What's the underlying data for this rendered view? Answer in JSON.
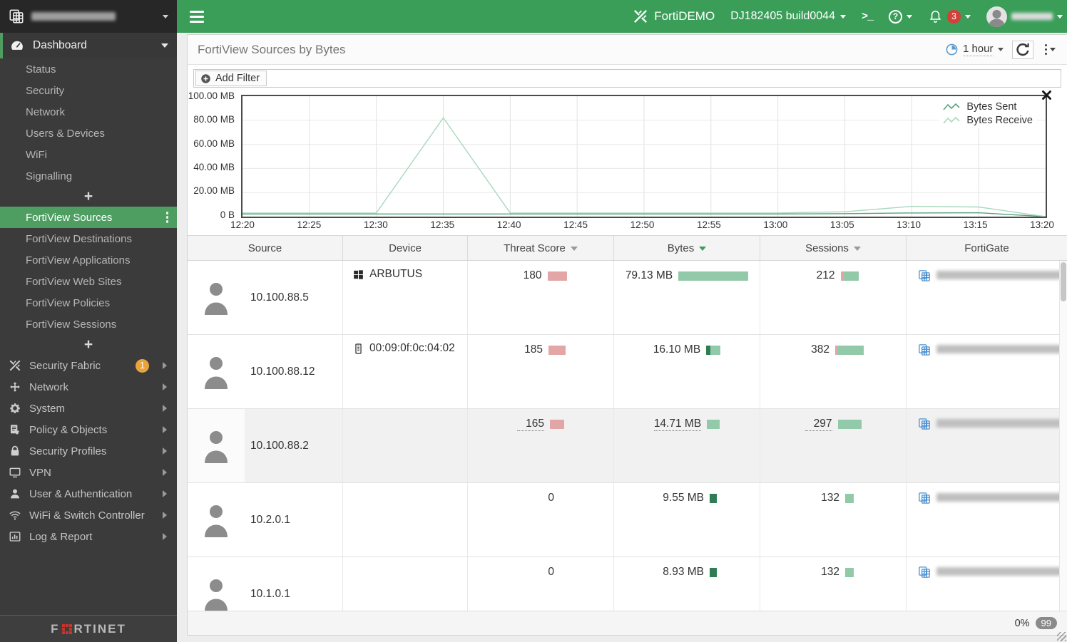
{
  "colors": {
    "topbar_green": "#3a9e59",
    "selected_green": "#4e9e61",
    "bar_light_green": "#92c9a9",
    "bar_dark_green": "#2f7d52",
    "bar_red": "#e2a6a6",
    "badge_orange": "#e8a33d",
    "badge_red": "#d43f3a",
    "line_sent": "#58a27b",
    "line_receive": "#a8d8bf",
    "fortigate_icon_blue": "#4a90d2"
  },
  "sidebar": {
    "device_name_redacted": true,
    "dashboard": {
      "label": "Dashboard"
    },
    "dashboard_items": [
      {
        "label": "Status"
      },
      {
        "label": "Security"
      },
      {
        "label": "Network"
      },
      {
        "label": "Users & Devices"
      },
      {
        "label": "WiFi"
      },
      {
        "label": "Signalling"
      }
    ],
    "add_label": "+",
    "fortiview_selected": {
      "label": "FortiView Sources"
    },
    "fortiview_items": [
      {
        "label": "FortiView Destinations"
      },
      {
        "label": "FortiView Applications"
      },
      {
        "label": "FortiView Web Sites"
      },
      {
        "label": "FortiView Policies"
      },
      {
        "label": "FortiView Sessions"
      }
    ],
    "menu_items": [
      {
        "label": "Security Fabric",
        "icon": "security-fabric",
        "badge": "1"
      },
      {
        "label": "Network",
        "icon": "network"
      },
      {
        "label": "System",
        "icon": "system-gear"
      },
      {
        "label": "Policy & Objects",
        "icon": "policy-objects"
      },
      {
        "label": "Security Profiles",
        "icon": "security-profiles"
      },
      {
        "label": "VPN",
        "icon": "vpn"
      },
      {
        "label": "User & Authentication",
        "icon": "user-auth"
      },
      {
        "label": "WiFi & Switch Controller",
        "icon": "wifi-switch"
      },
      {
        "label": "Log & Report",
        "icon": "log-report"
      }
    ],
    "footer_logo": {
      "left": "F",
      "right": "RTINET"
    }
  },
  "topbar": {
    "brand": "FortiDEMO",
    "build": "DJ182405 build0044",
    "notification_count": "3",
    "username_redacted": true
  },
  "panel": {
    "title": "FortiView Sources by Bytes",
    "time_range": "1 hour",
    "add_filter_label": "Add Filter",
    "status_percent": "0%",
    "status_badge": "99"
  },
  "chart_data": {
    "type": "line",
    "x": [
      "12:20",
      "12:25",
      "12:30",
      "12:35",
      "12:40",
      "12:45",
      "12:50",
      "12:55",
      "13:00",
      "13:05",
      "13:10",
      "13:15",
      "13:20"
    ],
    "series": [
      {
        "name": "Bytes Sent",
        "color": "#58a27b",
        "values": [
          2.2,
          2.2,
          2.2,
          2.2,
          2.2,
          2.2,
          2.2,
          2.2,
          2.2,
          2.5,
          3.0,
          3.2,
          0
        ]
      },
      {
        "name": "Bytes Receive",
        "color": "#a8d8bf",
        "values": [
          3.0,
          3.0,
          3.0,
          82.0,
          3.0,
          3.0,
          3.0,
          3.0,
          3.0,
          4.0,
          8.5,
          8.0,
          0
        ]
      }
    ],
    "unit": "MB",
    "ylim": [
      0,
      100
    ],
    "y_ticks": [
      "100.00 MB",
      "80.00 MB",
      "60.00 MB",
      "40.00 MB",
      "20.00 MB",
      "0 B"
    ],
    "grid": true,
    "legend_position": "top-right"
  },
  "table": {
    "columns": [
      {
        "label": "Source",
        "sort": "none"
      },
      {
        "label": "Device",
        "sort": "none"
      },
      {
        "label": "Threat Score",
        "sort": "inactive"
      },
      {
        "label": "Bytes",
        "sort": "active"
      },
      {
        "label": "Sessions",
        "sort": "inactive"
      },
      {
        "label": "FortiGate",
        "sort": "none"
      }
    ],
    "rows": [
      {
        "source": "10.100.88.5",
        "device": "ARBUTUS",
        "device_icon": "windows",
        "threat_score": "180",
        "threat_bar": 27,
        "bytes": "79.13 MB",
        "bytes_bar": [
          0,
          98
        ],
        "sessions": "212",
        "sessions_bar": [
          4,
          21
        ],
        "fortigate_redacted": true,
        "hovered": false
      },
      {
        "source": "10.100.88.12",
        "device": "00:09:0f:0c:04:02",
        "device_icon": "mac-device",
        "threat_score": "185",
        "threat_bar": 24,
        "bytes": "16.10 MB",
        "bytes_bar": [
          6,
          14
        ],
        "sessions": "382",
        "sessions_bar": [
          4,
          36
        ],
        "fortigate_redacted": true,
        "hovered": false
      },
      {
        "source": "10.100.88.2",
        "device": "",
        "device_icon": "",
        "threat_score": "165",
        "threat_bar": 20,
        "bytes": "14.71 MB",
        "bytes_bar": [
          0,
          18
        ],
        "sessions": "297",
        "sessions_bar": [
          0,
          33
        ],
        "fortigate_redacted": true,
        "hovered": true
      },
      {
        "source": "10.2.0.1",
        "device": "",
        "device_icon": "",
        "threat_score": "0",
        "threat_bar": 0,
        "bytes": "9.55 MB",
        "bytes_bar": [
          10,
          0
        ],
        "sessions": "132",
        "sessions_bar": [
          0,
          12
        ],
        "fortigate_redacted": true,
        "hovered": false
      },
      {
        "source": "10.1.0.1",
        "device": "",
        "device_icon": "",
        "threat_score": "0",
        "threat_bar": 0,
        "bytes": "8.93 MB",
        "bytes_bar": [
          10,
          0
        ],
        "sessions": "132",
        "sessions_bar": [
          0,
          12
        ],
        "fortigate_redacted": true,
        "hovered": false
      }
    ]
  }
}
